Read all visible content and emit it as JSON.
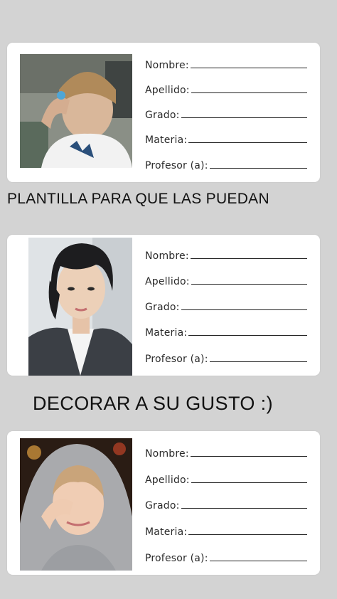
{
  "cards": [
    {
      "photo_alt": "person-photo-1",
      "fields": [
        {
          "label": "Nombre:"
        },
        {
          "label": "Apellido:"
        },
        {
          "label": "Grado:"
        },
        {
          "label": "Materia:"
        },
        {
          "label": "Profesor (a):"
        }
      ]
    },
    {
      "photo_alt": "person-photo-2",
      "fields": [
        {
          "label": "Nombre:"
        },
        {
          "label": "Apellido:"
        },
        {
          "label": "Grado:"
        },
        {
          "label": "Materia:"
        },
        {
          "label": "Profesor (a):"
        }
      ]
    },
    {
      "photo_alt": "person-photo-3",
      "fields": [
        {
          "label": "Nombre:"
        },
        {
          "label": "Apellido:"
        },
        {
          "label": "Grado:"
        },
        {
          "label": "Materia:"
        },
        {
          "label": "Profesor (a):"
        }
      ]
    }
  ],
  "captions": {
    "line1": "PLANTILLA PARA QUE LAS PUEDAN",
    "line2": "DECORAR A SU GUSTO :)"
  },
  "colors": {
    "background": "#d3d3d3",
    "card": "#ffffff",
    "text": "#111111"
  }
}
